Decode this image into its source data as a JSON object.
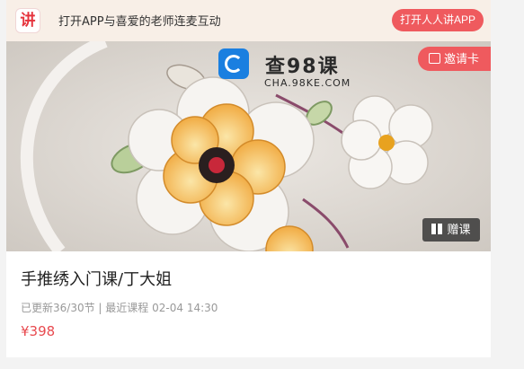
{
  "banner": {
    "logo_char": "讲",
    "promo_text": "打开APP与喜爱的老师连麦互动",
    "open_app_label": "打开人人讲APP"
  },
  "cover": {
    "watermark_title": "查98课",
    "watermark_domain": "CHA.98KE.COM",
    "invite_label": "邀请卡",
    "gift_label": "赠课"
  },
  "course": {
    "title": "手推绣入门课/丁大姐",
    "updated": "已更新36/30节",
    "separator": "|",
    "recent_label": "最近课程",
    "recent_time": "02-04 14:30",
    "price": "¥398"
  },
  "colors": {
    "accent": "#ef5a5e",
    "price": "#e84a4f",
    "banner_bg": "#f8efe7"
  }
}
